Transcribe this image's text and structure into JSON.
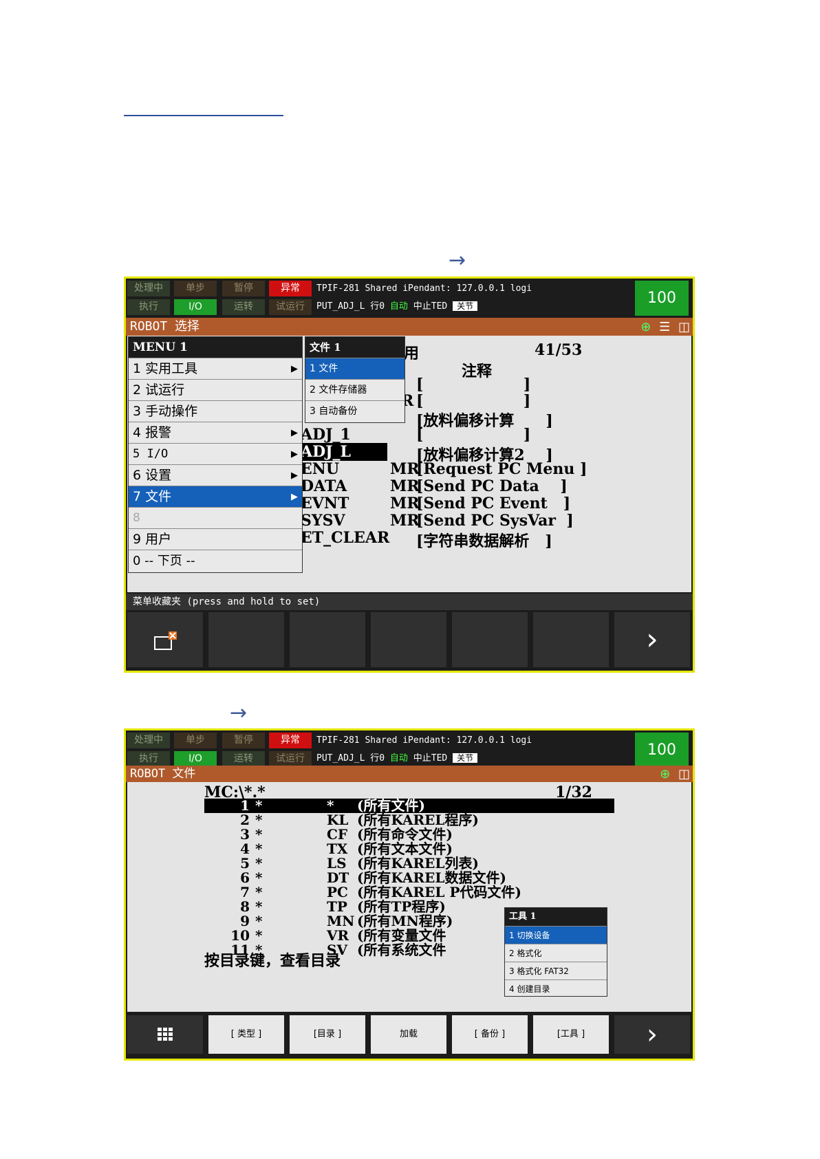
{
  "colors": {
    "accent_title": "#b05a2c",
    "status_green": "#1e9e2a",
    "status_red": "#d01010",
    "selection": "#1560b8",
    "frame_border": "#e4e600"
  },
  "arrows": [
    "→",
    "→"
  ],
  "header": {
    "status_row1": [
      "处理中",
      "单步",
      "暂停",
      "异常"
    ],
    "status_row2": [
      "执行",
      "I/O",
      "运转",
      "试运行"
    ],
    "line1": "TPIF-281 Shared iPendant: 127.0.0.1 logi",
    "line2_prog": "PUT_ADJ_L 行0",
    "line2_mode": "自动",
    "line2_status": "中止TED",
    "line2_joint": "关节",
    "override": "100"
  },
  "screen1": {
    "title": "ROBOT 选择",
    "list_header_type": "用",
    "page_count": "41/53",
    "comment_header": "注释",
    "rows": [
      {
        "name": "",
        "type": "",
        "comment": "[                   ]"
      },
      {
        "name": "",
        "type": "R",
        "comment": "[                   ]"
      },
      {
        "name": "",
        "type": "",
        "comment": "[放料偏移计算      ]"
      },
      {
        "name": "ADJ_1",
        "type": "",
        "comment": "[                   ]"
      },
      {
        "name": "ADJ_L",
        "type": "",
        "comment": "[放料偏移计算2    ]"
      },
      {
        "name": "ENU",
        "type": "MR",
        "comment": "[Request PC Menu ]"
      },
      {
        "name": "DATA",
        "type": "MR",
        "comment": "[Send PC Data    ]"
      },
      {
        "name": "EVNT",
        "type": "MR",
        "comment": "[Send PC Event   ]"
      },
      {
        "name": "SYSV",
        "type": "MR",
        "comment": "[Send PC SysVar  ]"
      },
      {
        "name": "ET_CLEAR",
        "type": "",
        "comment": "[字符串数据解析   ]"
      }
    ],
    "menu": {
      "title": "MENU   1",
      "items": [
        "1 实用工具",
        "2 试运行",
        "3 手动操作",
        "4 报警",
        "5 I/O",
        "6 设置",
        "7 文件",
        "8",
        "9 用户",
        "0 -- 下页 --"
      ]
    },
    "submenu": {
      "title": "文件    1",
      "items": [
        "1 文件",
        "2 文件存储器",
        "3 自动备份"
      ]
    },
    "favorites": "菜单收藏夹 (press and hold to set)",
    "fkey_next": "›"
  },
  "screen2": {
    "title": "ROBOT 文件",
    "path": "MC:\\*.*",
    "count": "1/32",
    "files": [
      {
        "num": "1",
        "name": "*",
        "ext": "*",
        "desc": "(所有文件)"
      },
      {
        "num": "2",
        "name": "*",
        "ext": "KL",
        "desc": "(所有KAREL程序)"
      },
      {
        "num": "3",
        "name": "*",
        "ext": "CF",
        "desc": "(所有命令文件)"
      },
      {
        "num": "4",
        "name": "*",
        "ext": "TX",
        "desc": "(所有文本文件)"
      },
      {
        "num": "5",
        "name": "*",
        "ext": "LS",
        "desc": "(所有KAREL列表)"
      },
      {
        "num": "6",
        "name": "*",
        "ext": "DT",
        "desc": "(所有KAREL数据文件)"
      },
      {
        "num": "7",
        "name": "*",
        "ext": "PC",
        "desc": "(所有KAREL P代码文件)"
      },
      {
        "num": "8",
        "name": "*",
        "ext": "TP",
        "desc": "(所有TP程序)"
      },
      {
        "num": "9",
        "name": "*",
        "ext": "MN",
        "desc": "(所有MN程序)"
      },
      {
        "num": "10",
        "name": "*",
        "ext": "VR",
        "desc": "(所有变量文件"
      },
      {
        "num": "11",
        "name": "*",
        "ext": "SV",
        "desc": "(所有系统文件"
      }
    ],
    "hint": "按目录键，查看目录",
    "tools_menu": {
      "title": "工具      1",
      "items": [
        "1 切换设备",
        "2 格式化",
        "3 格式化 FAT32",
        "4 创建目录"
      ]
    },
    "fkeys": [
      "[ 类型 ]",
      "[目录 ]",
      "加载",
      "[ 备份 ]",
      "[工具 ]"
    ],
    "fkey_next": "›"
  }
}
